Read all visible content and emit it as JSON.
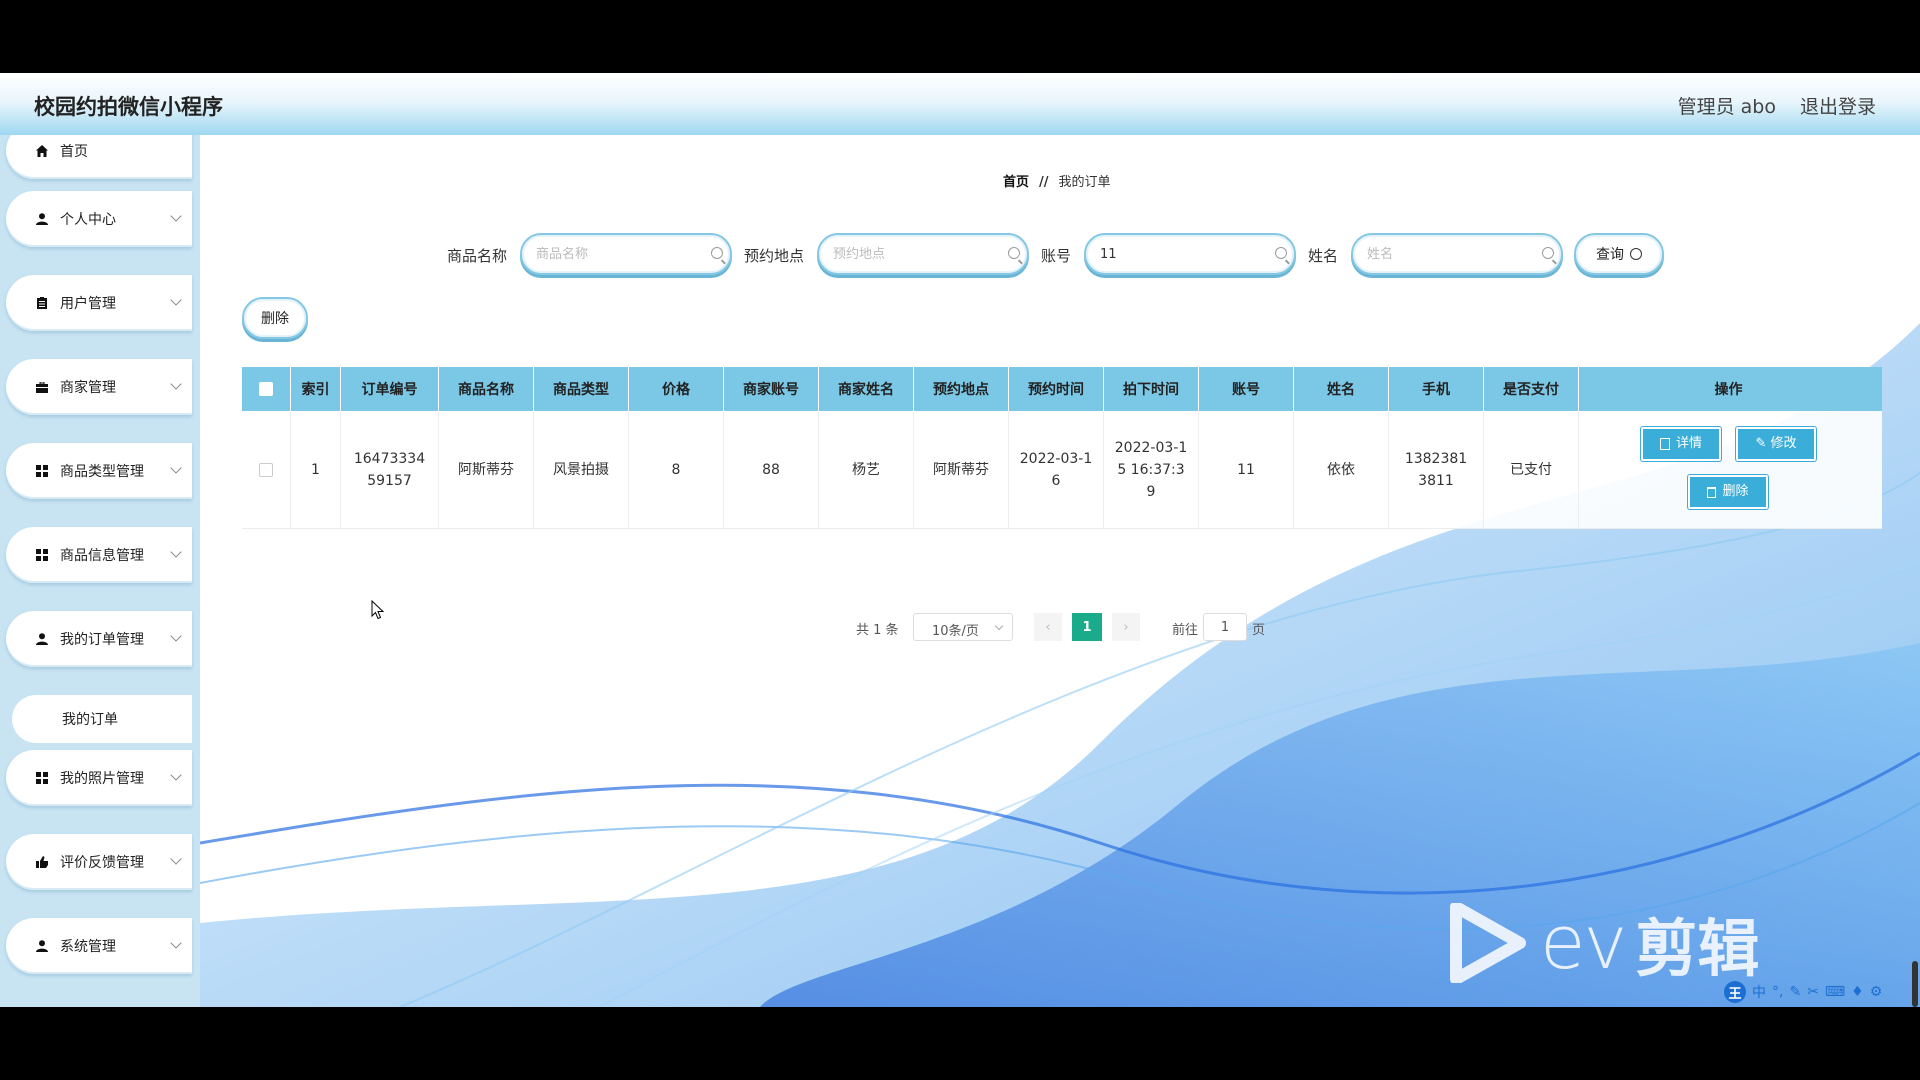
{
  "header": {
    "title": "校园约拍微信小程序",
    "user": "管理员 abo",
    "logout": "退出登录"
  },
  "sidebar": {
    "items": [
      {
        "label": "首页",
        "icon": "home-icon"
      },
      {
        "label": "个人中心",
        "icon": "person-icon"
      },
      {
        "label": "用户管理",
        "icon": "clipboard-icon"
      },
      {
        "label": "商家管理",
        "icon": "briefcase-icon"
      },
      {
        "label": "商品类型管理",
        "icon": "grid-icon"
      },
      {
        "label": "商品信息管理",
        "icon": "grid-icon"
      },
      {
        "label": "我的订单管理",
        "icon": "person-icon"
      },
      {
        "label": "我的照片管理",
        "icon": "grid-icon"
      },
      {
        "label": "评价反馈管理",
        "icon": "thumbs-up-icon"
      },
      {
        "label": "系统管理",
        "icon": "person-icon"
      }
    ],
    "subitem": "我的订单"
  },
  "breadcrumb": {
    "home": "首页",
    "separator": "//",
    "current": "我的订单"
  },
  "search": {
    "product_name_label": "商品名称",
    "product_name_placeholder": "商品名称",
    "product_name_value": "",
    "location_label": "预约地点",
    "location_placeholder": "预约地点",
    "location_value": "",
    "account_label": "账号",
    "account_value": "11",
    "name_label": "姓名",
    "name_placeholder": "姓名",
    "name_value": "",
    "query_button": "查询"
  },
  "actions": {
    "delete_button": "删除"
  },
  "table": {
    "headers": [
      "索引",
      "订单编号",
      "商品名称",
      "商品类型",
      "价格",
      "商家账号",
      "商家姓名",
      "预约地点",
      "预约时间",
      "拍下时间",
      "账号",
      "姓名",
      "手机",
      "是否支付",
      "操作"
    ],
    "rows": [
      {
        "index": "1",
        "order_no": "1647333459157",
        "product_name": "阿斯蒂芬",
        "product_type": "风景拍摄",
        "price": "8",
        "merchant_account": "88",
        "merchant_name": "杨艺",
        "location": "阿斯蒂芬",
        "appointment_time": "2022-03-16",
        "order_time": "2022-03-15 16:37:39",
        "account": "11",
        "name": "依依",
        "phone": "13823813811",
        "paid": "已支付",
        "detail_button": "详情",
        "edit_button": "修改",
        "delete_button": "删除"
      }
    ]
  },
  "pagination": {
    "total": "共 1 条",
    "page_size": "10条/页",
    "current_page": "1",
    "goto_label": "前往",
    "goto_value": "1",
    "page_unit": "页"
  },
  "watermark": {
    "text_latin": "ev",
    "text_cjk": "剪辑"
  },
  "ime": {
    "label": "王",
    "mode": "中"
  },
  "colors": {
    "accent": "#7bc8e6",
    "button": "#3aaed8",
    "page_active": "#1aab8a",
    "sidebar": "#c8e4f3"
  }
}
